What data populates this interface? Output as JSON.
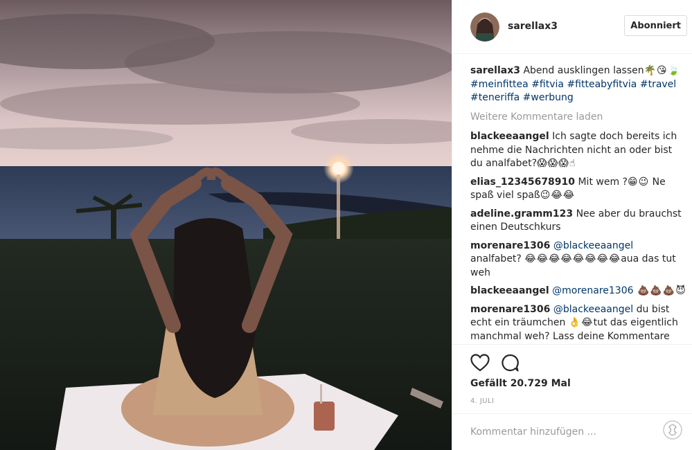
{
  "post": {
    "username": "sarellax3",
    "follow_label": "Abonniert",
    "caption_user": "sarellax3",
    "caption_text": " Abend ausklingen lassen",
    "caption_emoji": "🌴😘🍃",
    "caption_tags": [
      "#meinfittea",
      "#fitvia",
      "#fitteabyfitvia",
      "#travel",
      "#teneriffa",
      "#werbung"
    ],
    "load_more": "Weitere Kommentare laden",
    "likes": "Gefällt 20.729 Mal",
    "date": "4. JULI",
    "comment_placeholder": "Kommentar hinzufügen ..."
  },
  "comments": [
    {
      "user": "blackeeaangel",
      "text": " Ich sagte doch bereits ich nehme die Nachrichten nicht an oder bist du analfabet?",
      "emoji": "😱😱😱☝"
    },
    {
      "user": "elias_12345678910",
      "text": " Mit wem ?",
      "emoji": "😁😉",
      "text2": " Ne spaß viel spaß",
      "emoji2": "😉😂😂"
    },
    {
      "user": "adeline.gramm123",
      "text": " Nee aber du brauchst einen Deutschkurs"
    },
    {
      "user": "morenare1306",
      "mention": "@blackeeaangel",
      "text": " analfabet?",
      "emoji": "😂😂😂😂😂😂😂😂",
      "text2": "aua das tut weh"
    },
    {
      "user": "blackeeaangel",
      "mention": "@morenare1306",
      "emoji": " 💩💩💩😈"
    },
    {
      "user": "morenare1306",
      "mention": "@blackeeaangel",
      "text": " du bist echt ein träumchen ",
      "emoji": "👌😂",
      "text2": "tut das eigentlich manchmal weh? Lass deine Kommentare mal lieber sein!"
    }
  ],
  "colors": {
    "link": "#003569",
    "muted": "#999999",
    "border": "#efefef"
  },
  "icons": [
    "heart-icon",
    "comment-icon",
    "grammarly-icon",
    "avatar"
  ]
}
